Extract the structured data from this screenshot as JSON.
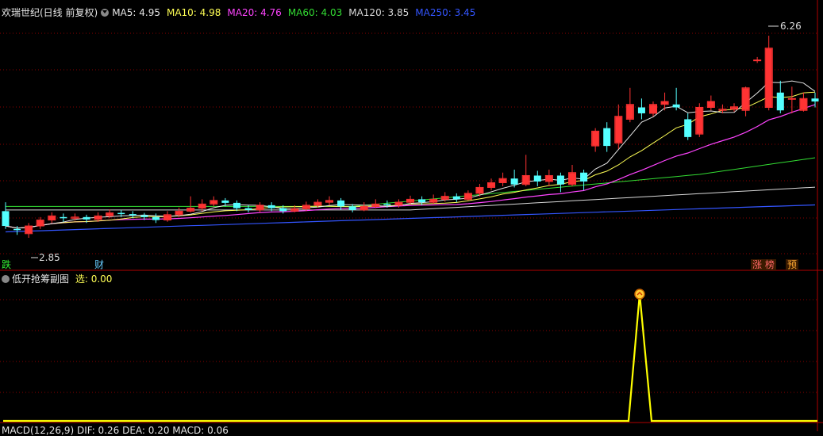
{
  "main": {
    "stock_name": "欢瑞世纪(日线 前复权)",
    "ma_items": [
      {
        "label": "MA5: 4.95",
        "color": "#e6e6e6"
      },
      {
        "label": "MA10: 4.98",
        "color": "#ffff55"
      },
      {
        "label": "MA20: 4.76",
        "color": "#ff44ff"
      },
      {
        "label": "MA60: 4.03",
        "color": "#33dd33"
      },
      {
        "label": "MA120: 3.85",
        "color": "#d8d8d8"
      },
      {
        "label": "MA250: 3.45",
        "color": "#3355ff"
      }
    ],
    "high_label": "6.26",
    "low_label": "2.85",
    "markers": {
      "left_a": "跌",
      "left_b": "财",
      "right_a": "涨 榜",
      "right_b": "预"
    }
  },
  "subchart": {
    "title": "低开抢筹副图",
    "xuan_label": "选:",
    "xuan_value": "0.00"
  },
  "bottom": {
    "macd_text": "MACD(12,26,9)  DIF: 0.26  DEA: 0.20  MACD: 0.06"
  },
  "colors": {
    "up": "#ff3333",
    "down": "#54ffff",
    "grid": "#8b0000",
    "signal": "#ffff00"
  },
  "chart_data": {
    "type": "candlestick",
    "high": 6.26,
    "low": 2.85,
    "candles": [
      [
        3.3,
        3.05,
        3.45,
        3.0
      ],
      [
        3.0,
        2.98,
        3.05,
        2.9
      ],
      [
        2.92,
        3.05,
        3.1,
        2.85
      ],
      [
        3.05,
        3.15,
        3.2,
        3.0
      ],
      [
        3.15,
        3.22,
        3.28,
        3.1
      ],
      [
        3.2,
        3.18,
        3.26,
        3.12
      ],
      [
        3.18,
        3.2,
        3.26,
        3.14
      ],
      [
        3.2,
        3.16,
        3.24,
        3.1
      ],
      [
        3.16,
        3.22,
        3.28,
        3.12
      ],
      [
        3.22,
        3.27,
        3.33,
        3.18
      ],
      [
        3.27,
        3.25,
        3.32,
        3.2
      ],
      [
        3.25,
        3.23,
        3.3,
        3.18
      ],
      [
        3.23,
        3.2,
        3.27,
        3.15
      ],
      [
        3.2,
        3.15,
        3.26,
        3.1
      ],
      [
        3.15,
        3.24,
        3.3,
        3.12
      ],
      [
        3.24,
        3.3,
        3.36,
        3.2
      ],
      [
        3.3,
        3.35,
        3.55,
        3.28
      ],
      [
        3.35,
        3.42,
        3.5,
        3.3
      ],
      [
        3.42,
        3.48,
        3.55,
        3.38
      ],
      [
        3.48,
        3.44,
        3.52,
        3.38
      ],
      [
        3.44,
        3.35,
        3.48,
        3.3
      ],
      [
        3.35,
        3.32,
        3.4,
        3.28
      ],
      [
        3.32,
        3.4,
        3.45,
        3.28
      ],
      [
        3.4,
        3.35,
        3.45,
        3.3
      ],
      [
        3.35,
        3.3,
        3.4,
        3.26
      ],
      [
        3.3,
        3.34,
        3.4,
        3.28
      ],
      [
        3.34,
        3.4,
        3.46,
        3.3
      ],
      [
        3.4,
        3.45,
        3.5,
        3.36
      ],
      [
        3.45,
        3.48,
        3.55,
        3.4
      ],
      [
        3.48,
        3.38,
        3.52,
        3.32
      ],
      [
        3.38,
        3.32,
        3.42,
        3.28
      ],
      [
        3.32,
        3.38,
        3.45,
        3.3
      ],
      [
        3.38,
        3.42,
        3.5,
        3.35
      ],
      [
        3.42,
        3.4,
        3.48,
        3.36
      ],
      [
        3.4,
        3.45,
        3.5,
        3.36
      ],
      [
        3.45,
        3.5,
        3.56,
        3.42
      ],
      [
        3.5,
        3.45,
        3.55,
        3.4
      ],
      [
        3.45,
        3.5,
        3.58,
        3.42
      ],
      [
        3.5,
        3.55,
        3.62,
        3.46
      ],
      [
        3.55,
        3.5,
        3.6,
        3.45
      ],
      [
        3.5,
        3.6,
        3.65,
        3.48
      ],
      [
        3.6,
        3.7,
        3.76,
        3.55
      ],
      [
        3.7,
        3.78,
        3.85,
        3.65
      ],
      [
        3.78,
        3.85,
        3.95,
        3.72
      ],
      [
        3.85,
        3.75,
        4.0,
        3.7
      ],
      [
        3.75,
        3.9,
        4.25,
        3.72
      ],
      [
        3.9,
        3.8,
        3.98,
        3.72
      ],
      [
        3.8,
        3.9,
        4.0,
        3.72
      ],
      [
        3.9,
        3.75,
        3.95,
        3.62
      ],
      [
        3.75,
        3.95,
        4.08,
        3.72
      ],
      [
        3.95,
        3.8,
        4.0,
        3.65
      ],
      [
        4.4,
        4.65,
        4.7,
        4.3
      ],
      [
        4.7,
        4.4,
        4.8,
        4.3
      ],
      [
        4.45,
        4.9,
        5.1,
        4.35
      ],
      [
        4.85,
        5.1,
        5.38,
        4.8
      ],
      [
        5.05,
        4.95,
        5.2,
        4.85
      ],
      [
        4.95,
        5.1,
        5.15,
        4.9
      ],
      [
        5.1,
        5.15,
        5.3,
        5.0
      ],
      [
        5.1,
        5.05,
        5.38,
        5.0
      ],
      [
        4.85,
        4.55,
        4.95,
        4.5
      ],
      [
        4.6,
        5.05,
        5.12,
        4.55
      ],
      [
        5.05,
        5.15,
        5.25,
        5.0
      ],
      [
        5.0,
        5.02,
        5.1,
        4.95
      ],
      [
        5.02,
        5.06,
        5.12,
        4.98
      ],
      [
        5.0,
        5.38,
        5.4,
        4.9
      ],
      [
        5.85,
        5.85,
        5.9,
        5.8
      ],
      [
        5.05,
        6.05,
        6.26,
        5.0
      ],
      [
        5.3,
        5.0,
        5.5,
        4.95
      ],
      [
        5.2,
        5.2,
        5.4,
        4.95
      ],
      [
        5.0,
        5.2,
        5.3,
        4.98
      ],
      [
        5.2,
        5.15,
        5.3,
        5.05
      ]
    ]
  }
}
